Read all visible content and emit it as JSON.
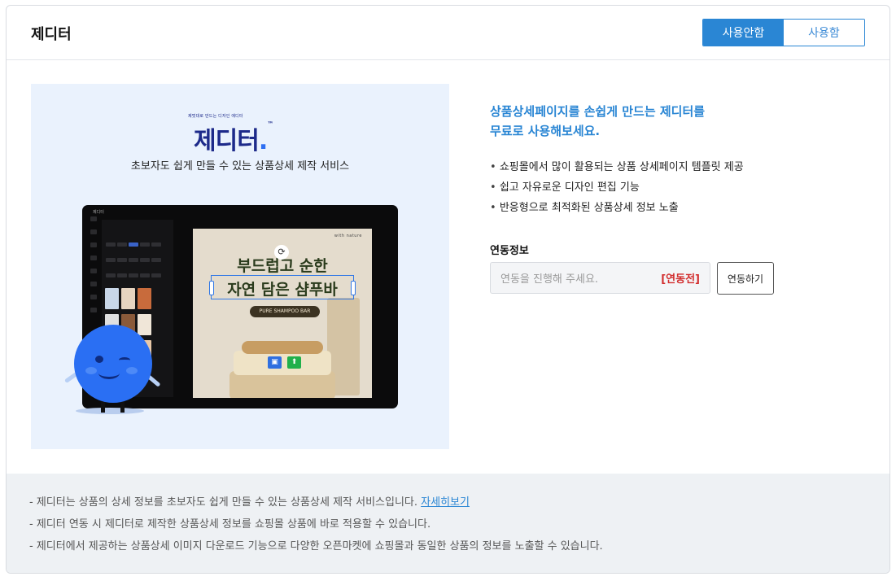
{
  "header": {
    "title": "제디터",
    "toggle": {
      "off_label": "사용안함",
      "on_label": "사용함",
      "selected": "사용안함"
    }
  },
  "promo": {
    "logo_tagline": "제멋대로 만드는 디자인 에디터",
    "logo_text": "제디터",
    "subtitle": "초보자도 쉽게 만들 수 있는 상품상세 제작 서비스",
    "mock": {
      "brand": "with nature",
      "headline_1": "부드럽고 순한",
      "headline_2": "자연 담은 샴푸바",
      "badge": "PURE SHAMPOO BAR"
    }
  },
  "info": {
    "headline_1": "상품상세페이지를 손쉽게 만드는 제디터를",
    "headline_2": "무료로 사용해보세요.",
    "features": [
      "쇼핑몰에서 많이 활용되는 상품 상세페이지 템플릿 제공",
      "쉽고 자유로운 디자인 편집 기능",
      "반응형으로 최적화된 상품상세 정보 노출"
    ],
    "link": {
      "label": "연동정보",
      "placeholder": "연동을 진행해 주세요.",
      "status": "[연동전]",
      "button": "연동하기"
    }
  },
  "footer": {
    "notes": [
      "- 제디터는 상품의 상세 정보를 초보자도 쉽게 만들 수 있는 상품상세 제작 서비스입니다.",
      "- 제디터 연동 시 제디터로 제작한 상품상세 정보를 쇼핑몰 상품에 바로 적용할 수 있습니다.",
      "- 제디터에서 제공하는 상품상세 이미지 다운로드 기능으로 다양한 오픈마켓에 쇼핑몰과 동일한 상품의 정보를 노출할 수 있습니다."
    ],
    "more_link": "자세히보기"
  },
  "colors": {
    "accent": "#2a86d4",
    "status_red": "#d22d2d",
    "footer_bg": "#eef1f4",
    "promo_bg": "#eaf2fd"
  }
}
